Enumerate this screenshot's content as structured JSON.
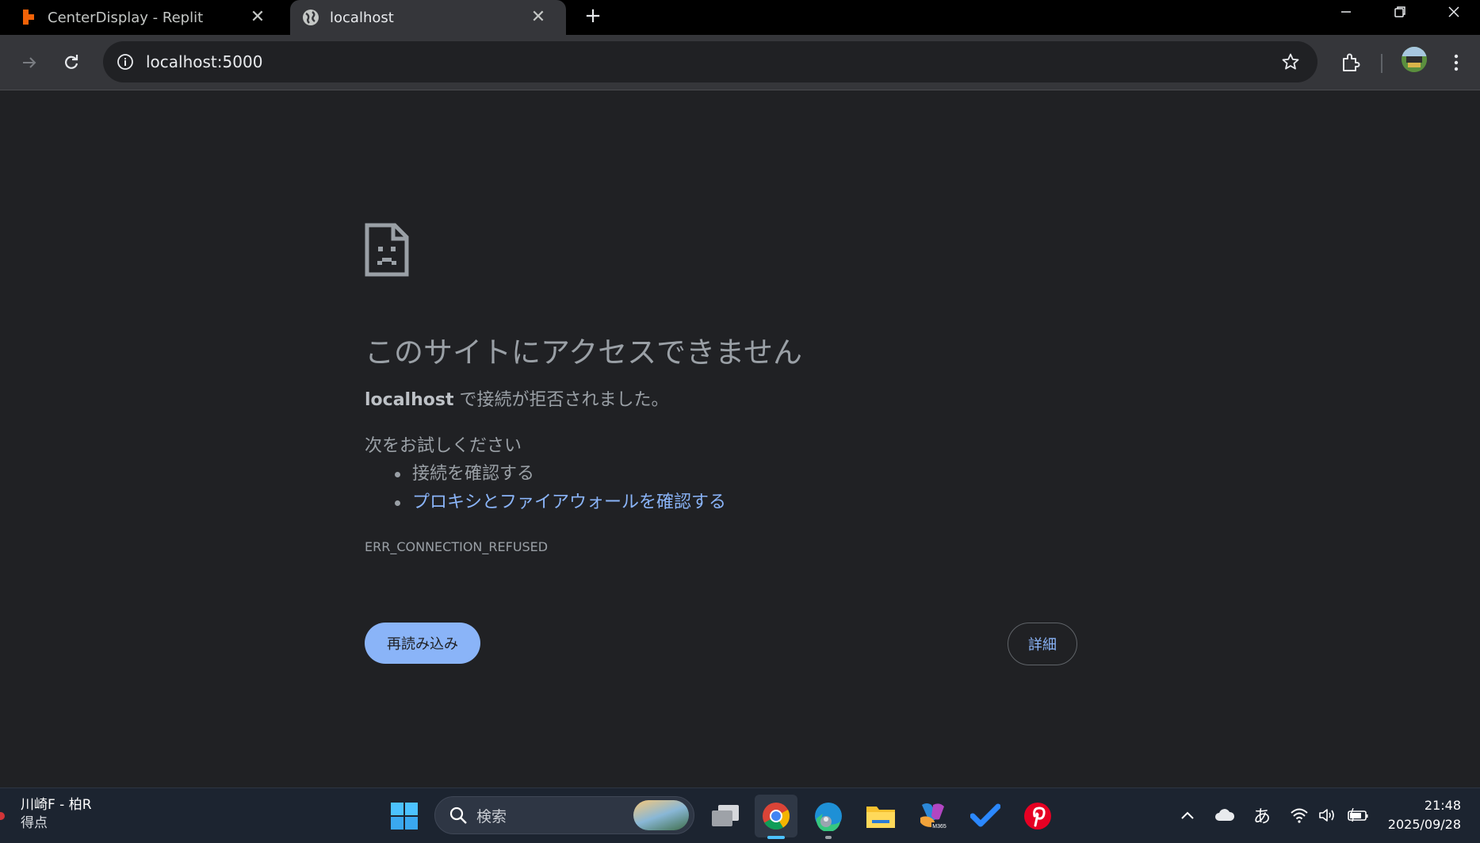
{
  "browser": {
    "tabs": [
      {
        "title": "CenterDisplay - Replit",
        "favicon": "replit-icon",
        "active": false
      },
      {
        "title": "localhost",
        "favicon": "globe-icon",
        "active": true
      }
    ],
    "new_tab_label": "+",
    "omnibox": {
      "url": "localhost:5000"
    }
  },
  "error_page": {
    "headline": "このサイトにアクセスできません",
    "host": "localhost",
    "description_rest": " で接続が拒否されました。",
    "suggestions_heading": "次をお試しください",
    "suggestions": [
      {
        "text": "接続を確認する",
        "is_link": false
      },
      {
        "text": "プロキシとファイアウォールを確認する",
        "is_link": true
      }
    ],
    "error_code": "ERR_CONNECTION_REFUSED",
    "reload_button": "再読み込み",
    "details_button": "詳細"
  },
  "taskbar": {
    "widget": {
      "line1": "川崎F - 柏R",
      "line2": "得点"
    },
    "search_placeholder": "検索",
    "ime_indicator": "あ",
    "clock": {
      "time": "21:48",
      "date": "2025/09/28"
    },
    "apps": [
      "task-view",
      "chrome",
      "edge",
      "file-explorer",
      "microsoft-365",
      "todo",
      "pinterest"
    ]
  },
  "colors": {
    "accent": "#8ab4f8",
    "page_bg": "#202124",
    "text": "#9aa0a6"
  }
}
